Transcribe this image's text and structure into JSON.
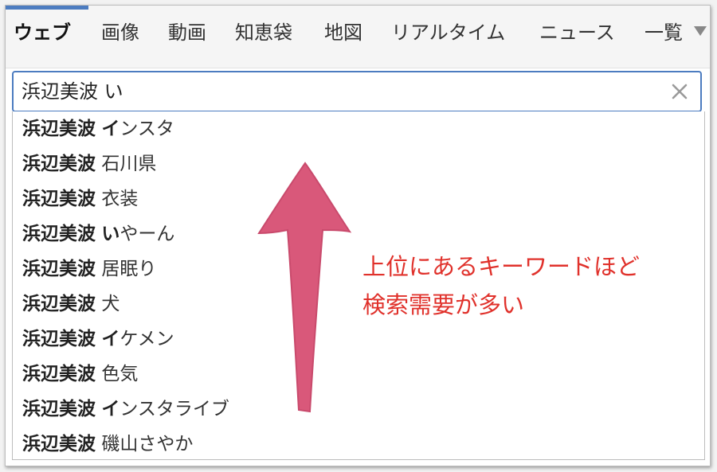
{
  "tabs": [
    {
      "label": "ウェブ",
      "active": true
    },
    {
      "label": "画像",
      "active": false
    },
    {
      "label": "動画",
      "active": false
    },
    {
      "label": "知恵袋",
      "active": false
    },
    {
      "label": "地図",
      "active": false
    },
    {
      "label": "リアルタイム",
      "active": false
    },
    {
      "label": "ニュース",
      "active": false
    },
    {
      "label": "一覧",
      "active": false
    }
  ],
  "search": {
    "value": "浜辺美波 い",
    "clear_icon": "close-icon"
  },
  "suggestions": [
    {
      "query": "浜辺美波",
      "highlight": "イ",
      "rest": "ンスタ"
    },
    {
      "query": "浜辺美波",
      "highlight": "",
      "rest": "石川県"
    },
    {
      "query": "浜辺美波",
      "highlight": "",
      "rest": "衣装"
    },
    {
      "query": "浜辺美波",
      "highlight": "い",
      "rest": "やーん"
    },
    {
      "query": "浜辺美波",
      "highlight": "",
      "rest": "居眠り"
    },
    {
      "query": "浜辺美波",
      "highlight": "",
      "rest": "犬"
    },
    {
      "query": "浜辺美波",
      "highlight": "イ",
      "rest": "ケメン"
    },
    {
      "query": "浜辺美波",
      "highlight": "",
      "rest": "色気"
    },
    {
      "query": "浜辺美波",
      "highlight": "イ",
      "rest": "ンスタライブ"
    },
    {
      "query": "浜辺美波",
      "highlight": "",
      "rest": "磯山さやか"
    }
  ],
  "annotation": {
    "line1": "上位にあるキーワードほど",
    "line2": "検索需要が多い",
    "arrow_color": "#d9587a",
    "text_color": "#e0312b"
  },
  "colors": {
    "accent": "#4c7cc0"
  }
}
